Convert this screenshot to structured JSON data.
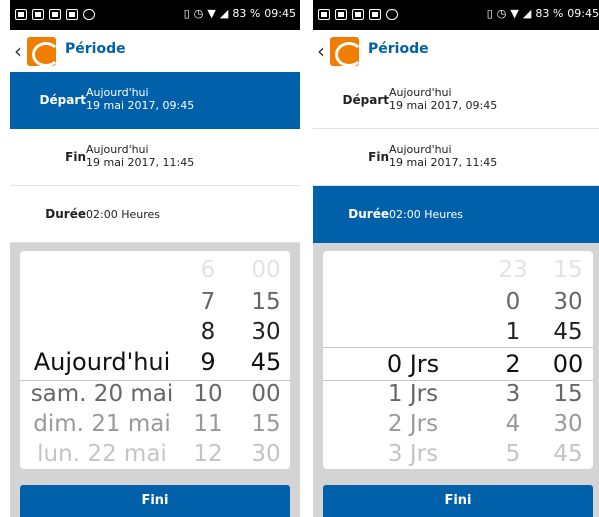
{
  "screens": [
    {
      "status": {
        "battery": "83 %",
        "time": "09:45"
      },
      "title": "Période",
      "rows": [
        {
          "label": "Départ",
          "line1": "Aujourd'hui",
          "line2": "19 mai 2017, 09:45",
          "selected": true
        },
        {
          "label": "Fin",
          "line1": "Aujourd'hui",
          "line2": "19 mai 2017, 11:45",
          "selected": false
        },
        {
          "label": "Durée",
          "line1": "02:00 Heures",
          "line2": "",
          "selected": false
        }
      ],
      "picker": {
        "columns": [
          {
            "name": "date",
            "items": [
              "",
              "",
              "Aujourd'hui",
              "sam. 20 mai",
              "dim. 21 mai",
              "lun. 22 mai"
            ]
          },
          {
            "name": "hour",
            "items": [
              "6",
              "7",
              "8",
              "9",
              "10",
              "11",
              "12"
            ]
          },
          {
            "name": "minute",
            "items": [
              "00",
              "15",
              "30",
              "45",
              "00",
              "15",
              "30"
            ]
          }
        ]
      },
      "done_label": "Fini"
    },
    {
      "status": {
        "battery": "83 %",
        "time": "09:45"
      },
      "title": "Période",
      "rows": [
        {
          "label": "Départ",
          "line1": "Aujourd'hui",
          "line2": "19 mai 2017, 09:45",
          "selected": false
        },
        {
          "label": "Fin",
          "line1": "Aujourd'hui",
          "line2": "19 mai 2017, 11:45",
          "selected": false
        },
        {
          "label": "Durée",
          "line1": "02:00 Heures",
          "line2": "",
          "selected": true
        }
      ],
      "picker": {
        "columns": [
          {
            "name": "days",
            "items": [
              "",
              "",
              "",
              "0 Jrs",
              "1 Jrs",
              "2 Jrs",
              "3 Jrs"
            ]
          },
          {
            "name": "hour",
            "items": [
              "23",
              "0",
              "1",
              "2",
              "3",
              "4",
              "5"
            ]
          },
          {
            "name": "minute",
            "items": [
              "15",
              "30",
              "45",
              "00",
              "15",
              "30",
              "45"
            ]
          }
        ]
      },
      "done_label": "Fini"
    }
  ],
  "colors": {
    "primary": "#0060aa",
    "logo": "#f07d00",
    "picker_bg": "#d4d4d4"
  },
  "icons": [
    "image-icon",
    "message-icon",
    "vibrate-icon",
    "alarm-icon",
    "wifi-icon",
    "signal-icon",
    "back-chevron-icon",
    "app-logo-icon"
  ]
}
